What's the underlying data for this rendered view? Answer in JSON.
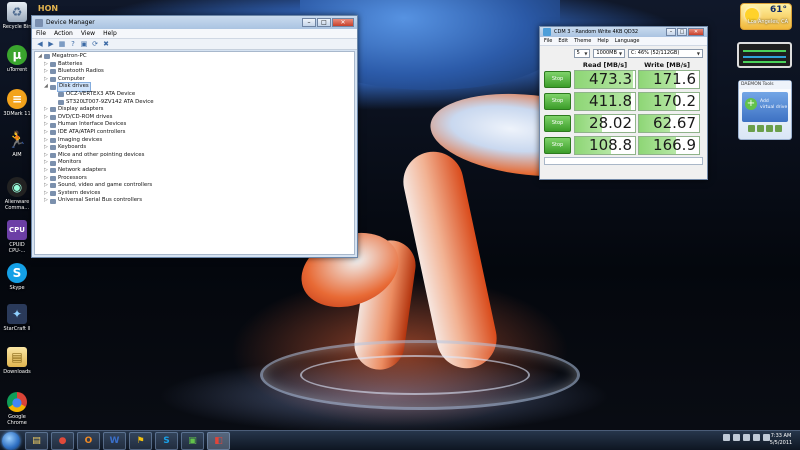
{
  "desktop": {
    "icons": [
      {
        "label": "Recycle Bin",
        "icon": "recycle-bin-icon"
      },
      {
        "label": "uTorrent",
        "icon": "utorrent-icon"
      },
      {
        "label": "3DMark 11",
        "icon": "3dmark-icon"
      },
      {
        "label": "AIM",
        "icon": "aim-icon"
      },
      {
        "label": "Alienware Comma...",
        "icon": "alienware-icon"
      },
      {
        "label": "CPUID CPU-...",
        "icon": "cpuz-icon"
      },
      {
        "label": "Skype",
        "icon": "skype-icon"
      },
      {
        "label": "StarCraft II",
        "icon": "starcraft-icon"
      },
      {
        "label": "Downloads",
        "icon": "folder-icon"
      },
      {
        "label": "Google Chrome",
        "icon": "chrome-icon"
      }
    ],
    "hon_logo": "HON"
  },
  "device_manager": {
    "title": "Device Manager",
    "menu": [
      "File",
      "Action",
      "View",
      "Help"
    ],
    "toolbar_icons": [
      "back-icon",
      "forward-icon",
      "properties-icon",
      "help-icon",
      "scan-icon",
      "update-icon",
      "uninstall-icon"
    ],
    "tree": [
      {
        "label": "Megatron-PC",
        "level": 0,
        "expanded": true
      },
      {
        "label": "Batteries",
        "level": 1
      },
      {
        "label": "Bluetooth Radios",
        "level": 1
      },
      {
        "label": "Computer",
        "level": 1
      },
      {
        "label": "Disk drives",
        "level": 1,
        "expanded": true,
        "selected": true
      },
      {
        "label": "OCZ-VERTEX3 ATA Device",
        "level": 2
      },
      {
        "label": "ST320LT007-9ZV142 ATA Device",
        "level": 2
      },
      {
        "label": "Display adapters",
        "level": 1
      },
      {
        "label": "DVD/CD-ROM drives",
        "level": 1
      },
      {
        "label": "Human Interface Devices",
        "level": 1
      },
      {
        "label": "IDE ATA/ATAPI controllers",
        "level": 1
      },
      {
        "label": "Imaging devices",
        "level": 1
      },
      {
        "label": "Keyboards",
        "level": 1
      },
      {
        "label": "Mice and other pointing devices",
        "level": 1
      },
      {
        "label": "Monitors",
        "level": 1
      },
      {
        "label": "Network adapters",
        "level": 1
      },
      {
        "label": "Processors",
        "level": 1
      },
      {
        "label": "Sound, video and game controllers",
        "level": 1
      },
      {
        "label": "System devices",
        "level": 1
      },
      {
        "label": "Universal Serial Bus controllers",
        "level": 1
      }
    ]
  },
  "cdm": {
    "title": "CDM 3 - Random Write 4KB QD32",
    "menu": [
      "File",
      "Edit",
      "Theme",
      "Help",
      "Language"
    ],
    "count": "5",
    "size": "1000MB",
    "drive": "C: 46% (52/112GB)",
    "read_header": "Read [MB/s]",
    "write_header": "Write [MB/s]",
    "rows": [
      {
        "button": "Stop",
        "read": "473.3",
        "write": "171.6"
      },
      {
        "button": "Stop",
        "read": "411.8",
        "write": "170.2"
      },
      {
        "button": "Stop",
        "read": "28.02",
        "write": "62.67"
      },
      {
        "button": "Stop",
        "read": "108.8",
        "write": "166.9"
      }
    ]
  },
  "gadgets": {
    "weather_temp": "61°",
    "weather_city": "Los Angeles, CA",
    "daemon_header": "DAEMON Tools",
    "daemon_label_1": "Add",
    "daemon_label_2": "virtual drive"
  },
  "taskbar": {
    "pinned": [
      "explorer-icon",
      "chrome-icon",
      "outlook-icon",
      "word-icon",
      "aim-icon",
      "skype-icon",
      "app-icon",
      "cdm-icon"
    ],
    "time": "7:33 AM",
    "date": "5/5/2011"
  }
}
